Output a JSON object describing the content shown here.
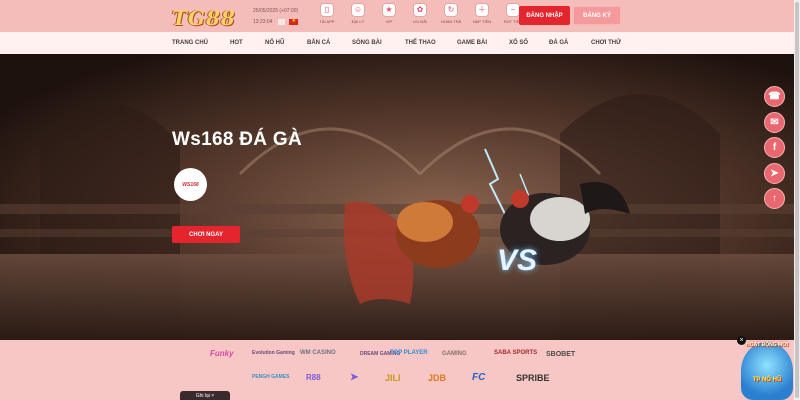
{
  "header": {
    "logo_text": "TG88",
    "date": "25/05/2025 (+07:00)",
    "time": "13:23:04",
    "quick_nav": [
      {
        "label": "TẢI APP",
        "icon": "phone-download-icon",
        "glyph": "▯"
      },
      {
        "label": "ĐẠI LÝ",
        "icon": "agent-icon",
        "glyph": "☺"
      },
      {
        "label": "VIP",
        "icon": "vip-star-icon",
        "glyph": "★"
      },
      {
        "label": "ƯU ĐÃI",
        "icon": "gift-icon",
        "glyph": "✿"
      },
      {
        "label": "HOÀN TRẢ",
        "icon": "refund-icon",
        "glyph": "↻"
      },
      {
        "label": "NẠP TIỀN",
        "icon": "deposit-icon",
        "glyph": "＋"
      },
      {
        "label": "RÚT TIỀN",
        "icon": "withdraw-icon",
        "glyph": "−"
      }
    ],
    "login_label": "ĐĂNG NHẬP",
    "register_label": "ĐĂNG KÝ"
  },
  "nav": {
    "items": [
      "TRANG CHỦ",
      "HOT",
      "NỔ HŨ",
      "BẮN CÁ",
      "SÒNG BÀI",
      "THỂ THAO",
      "GAME BÀI",
      "XỔ SỐ",
      "ĐÁ GÀ",
      "CHƠI THỬ"
    ]
  },
  "hero": {
    "title": "Ws168 ĐÁ GÀ",
    "badge_text": "WS168",
    "cta_label": "CHƠI NGAY",
    "vs_text": "VS"
  },
  "side_float": [
    {
      "icon": "support-chat-icon",
      "glyph": "☎"
    },
    {
      "icon": "gift-box-icon",
      "glyph": "✉"
    },
    {
      "icon": "facebook-icon",
      "glyph": "f"
    },
    {
      "icon": "telegram-icon",
      "glyph": "➤"
    },
    {
      "icon": "scroll-top-icon",
      "glyph": "↑"
    }
  ],
  "partners": {
    "row1": [
      "Funky",
      "Evolution Gaming",
      "WM CASINO",
      "DREAM GAMING",
      "TOP PLAYER",
      "GAMING",
      "SABA SPORTS",
      "SBOBET"
    ],
    "row2": [
      "PENGH GAMES",
      "R88",
      "JILI",
      "JDB",
      "FC",
      "SPRIBE"
    ]
  },
  "footer": {
    "ghi_lai": "Ghi lại ×"
  },
  "promo": {
    "top_text": "HOẠT ĐỘNG MỚI",
    "bottom_text": "TP NỔ HŨ"
  },
  "colors": {
    "brand_red": "#e4252e",
    "header_bg": "#f4bdb9",
    "nav_bg": "#fff1ef",
    "page_bg": "#f6c7c4"
  }
}
